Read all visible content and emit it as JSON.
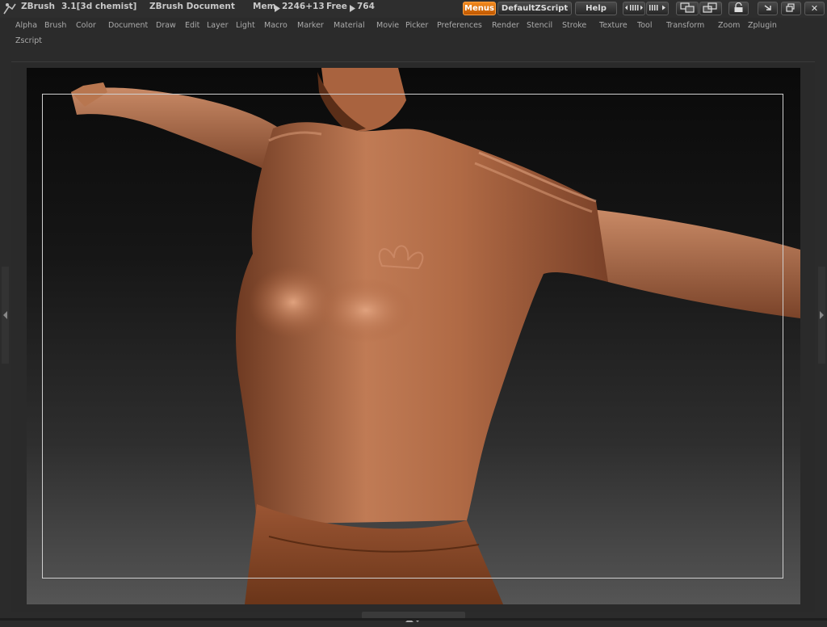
{
  "title": {
    "app": "ZBrush",
    "version": "3.1[3d chemist]",
    "document": "ZBrush Document",
    "mem_label": "Mem",
    "mem_value": "2246+13",
    "free_label": "Free",
    "free_value": "764"
  },
  "toolbar": {
    "menus": "Menus",
    "script": "DefaultZScript",
    "help": "Help",
    "minimize_icon": "minimize-icon",
    "restore_icon": "restore-icon",
    "close_glyph": "✕"
  },
  "menus": [
    "Alpha",
    "Brush",
    "Color",
    "Document",
    "Draw",
    "Edit",
    "Layer",
    "Light",
    "Macro",
    "Marker",
    "Material",
    "Movie",
    "Picker",
    "Preferences",
    "Render",
    "Stencil",
    "Stroke",
    "Texture",
    "Tool",
    "Transform",
    "Zoom",
    "Zplugin",
    "Zscript"
  ],
  "colors": {
    "accent": "#e07a10",
    "clay": "#b86a45",
    "background": "#2b2b2b"
  }
}
